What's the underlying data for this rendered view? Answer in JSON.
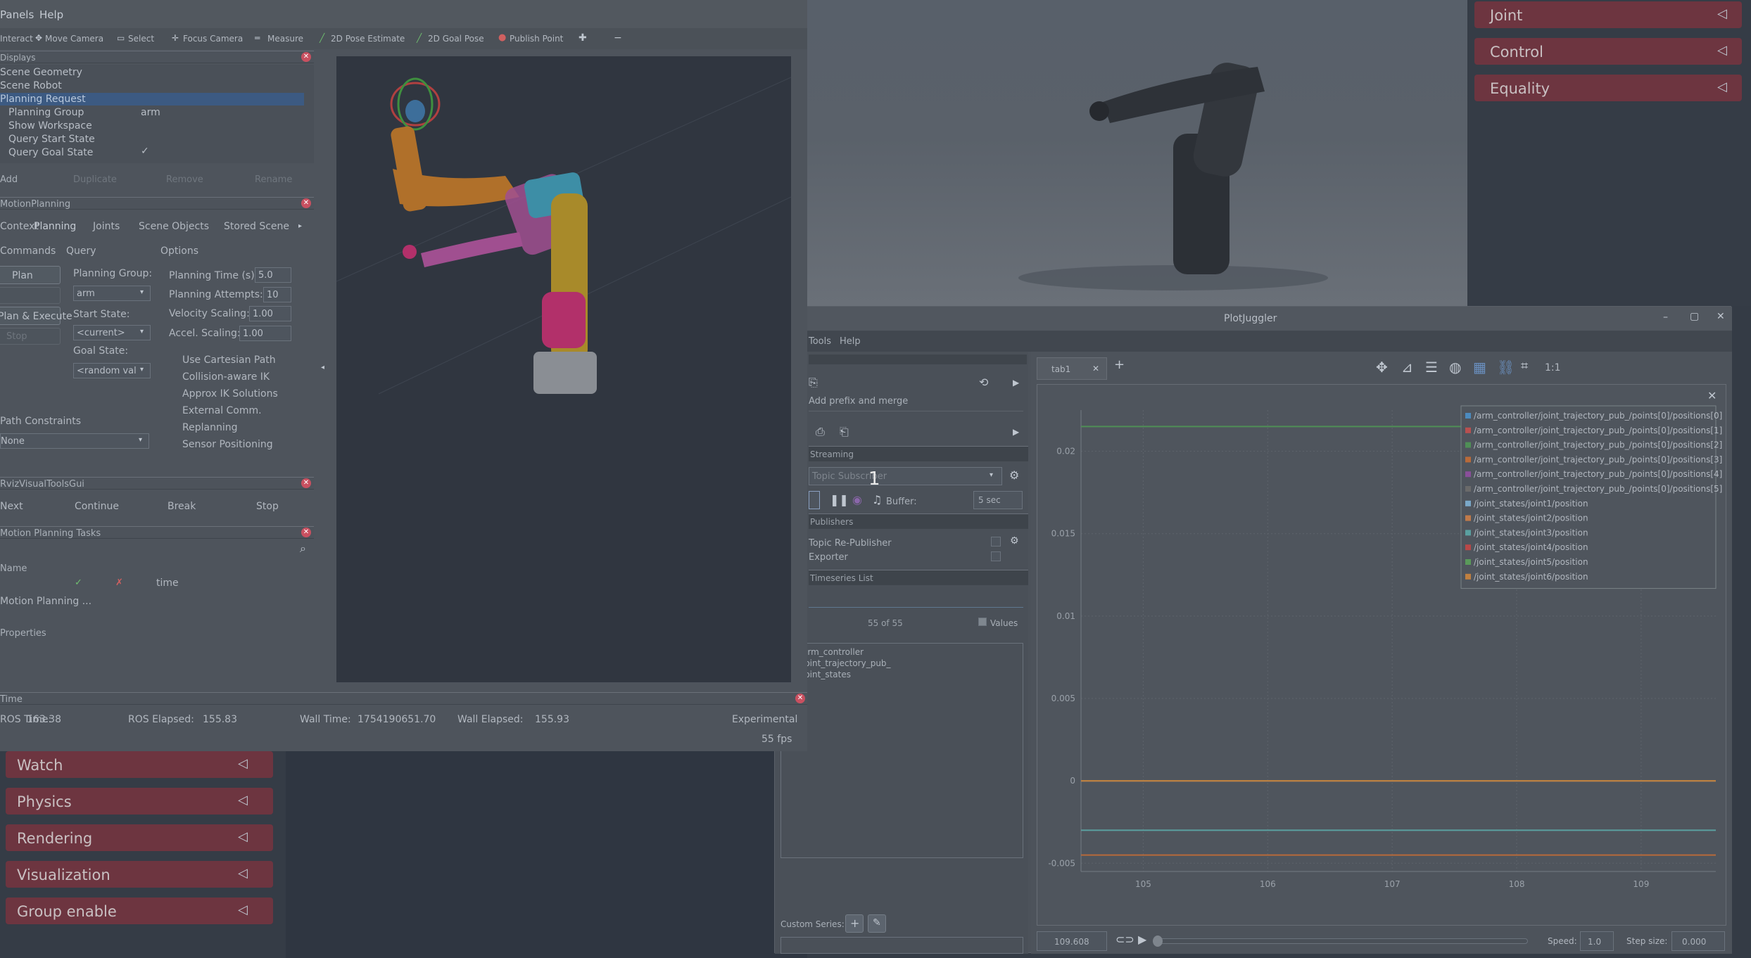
{
  "rviz": {
    "menu": [
      "Panels",
      "Help"
    ],
    "toolbar": [
      "Interact",
      "Move Camera",
      "Select",
      "Focus Camera",
      "Measure",
      "2D Pose Estimate",
      "2D Goal Pose",
      "Publish Point"
    ],
    "displays_title": "Displays",
    "displays_items": [
      {
        "label": "Scene Geometry",
        "value": ""
      },
      {
        "label": "Scene Robot",
        "value": ""
      },
      {
        "label": "Planning Request",
        "value": ""
      },
      {
        "label": "Planning Group",
        "value": "arm"
      },
      {
        "label": "Show Workspace",
        "value": ""
      },
      {
        "label": "Query Start State",
        "value": ""
      },
      {
        "label": "Query Goal State",
        "value": "✓"
      }
    ],
    "displays_buttons": [
      "Add",
      "Duplicate",
      "Remove",
      "Rename"
    ],
    "motion_title": "MotionPlanning",
    "motion_tabs": [
      "Context",
      "Planning",
      "Joints",
      "Scene Objects",
      "Stored Scene"
    ],
    "commands_label": "Commands",
    "query_label": "Query",
    "options_label": "Options",
    "plan_button": "Plan",
    "plan_execute_button": "Plan & Execute",
    "stop_button": "Stop",
    "planning_group_label": "Planning Group:",
    "planning_group_value": "arm",
    "start_state_label": "Start State:",
    "start_state_value": "<current>",
    "goal_state_label": "Goal State:",
    "goal_state_value": "<random val",
    "planning_time_label": "Planning Time (s):",
    "planning_time_value": "5.0",
    "planning_attempts_label": "Planning Attempts:",
    "planning_attempts_value": "10",
    "velocity_label": "Velocity Scaling:",
    "velocity_value": "1.00",
    "accel_label": "Accel. Scaling:",
    "accel_value": "1.00",
    "checks": [
      "Use Cartesian Path",
      "Collision-aware IK",
      "Approx IK Solutions",
      "External Comm.",
      "Replanning",
      "Sensor Positioning"
    ],
    "path_constraints_label": "Path Constraints",
    "path_constraints_value": "None",
    "rvt_title": "RvizVisualToolsGui",
    "rvt_buttons": [
      "Next",
      "Continue",
      "Break",
      "Stop"
    ],
    "mpt_title": "Motion Planning Tasks",
    "mpt_name_col": "Name",
    "mpt_time_col": "time",
    "mpt_row": "Motion Planning ...",
    "mpt_properties": "Properties",
    "time_title": "Time",
    "ros_time_label": "ROS Time:",
    "ros_time_value": "163.38",
    "ros_elapsed_label": "ROS Elapsed:",
    "ros_elapsed_value": "155.83",
    "wall_time_label": "Wall Time:",
    "wall_time_value": "1754190651.70",
    "wall_elapsed_label": "Wall Elapsed:",
    "wall_elapsed_value": "155.93",
    "experimental": "Experimental",
    "fps": "55 fps"
  },
  "mujoco": {
    "right_sections": [
      "Joint",
      "Control",
      "Equality"
    ],
    "left_sections": [
      "Watch",
      "Physics",
      "Rendering",
      "Visualization",
      "Group enable"
    ]
  },
  "plotjuggler": {
    "title": "PlotJuggler",
    "menu": [
      "Tools",
      "Help"
    ],
    "prefix_merge": "Add prefix and merge",
    "streaming_label": "Streaming",
    "topic_placeholder": "Topic Subscriber",
    "buffer_label": "Buffer:",
    "buffer_value": "5 sec",
    "publishers_label": "Publishers",
    "republisher_label": "Topic Re-Publisher",
    "exporter_label": "Exporter",
    "timeseries_label": "Timeseries List",
    "count_label": "55 of 55",
    "values_label": "Values",
    "tree": [
      "arm_controller",
      "joint_trajectory_pub_",
      "joint_states"
    ],
    "custom_series_label": "Custom Series:",
    "tab_label": "tab1",
    "current_time": "109.608",
    "speed_label": "Speed:",
    "speed_value": "1.0",
    "step_label": "Step size:",
    "step_value": "0.000",
    "one_to_one": "1:1",
    "badge": "1"
  },
  "chart_data": {
    "type": "line",
    "x_ticks": [
      "105",
      "106",
      "107",
      "108",
      "109"
    ],
    "y_ticks": [
      "0.02",
      "0.015",
      "0.01",
      "0.005",
      "0",
      "-0.005"
    ],
    "xlim": [
      104.5,
      109.6
    ],
    "ylim": [
      -0.0055,
      0.0225
    ],
    "grid": true,
    "legend_position": "top-right",
    "series": [
      {
        "name": "/arm_controller/joint_trajectory_pub_/points[0]/positions[0]",
        "color": "#4c8bbf",
        "x": [
          104.5,
          109.6
        ],
        "y": [
          0,
          0
        ]
      },
      {
        "name": "/arm_controller/joint_trajectory_pub_/points[0]/positions[1]",
        "color": "#b85050",
        "x": [
          104.5,
          109.6
        ],
        "y": [
          0,
          0
        ]
      },
      {
        "name": "/arm_controller/joint_trajectory_pub_/points[0]/positions[2]",
        "color": "#4f8f56",
        "x": [
          104.5,
          109.6
        ],
        "y": [
          0.0215,
          0.0215
        ]
      },
      {
        "name": "/arm_controller/joint_trajectory_pub_/points[0]/positions[3]",
        "color": "#b86a3a",
        "x": [
          104.5,
          109.6
        ],
        "y": [
          -0.0045,
          -0.0045
        ]
      },
      {
        "name": "/arm_controller/joint_trajectory_pub_/points[0]/positions[4]",
        "color": "#8a4f9a",
        "x": [
          104.5,
          109.6
        ],
        "y": [
          0,
          0
        ]
      },
      {
        "name": "/arm_controller/joint_trajectory_pub_/points[0]/positions[5]",
        "color": "#6a6a6a",
        "x": [
          104.5,
          109.6
        ],
        "y": [
          0,
          0
        ]
      },
      {
        "name": "/joint_states/joint1/position",
        "color": "#7aa8c8",
        "x": [
          104.5,
          109.6
        ],
        "y": [
          0,
          0
        ]
      },
      {
        "name": "/joint_states/joint2/position",
        "color": "#c07a4a",
        "x": [
          104.5,
          109.6
        ],
        "y": [
          0,
          0
        ]
      },
      {
        "name": "/joint_states/joint3/position",
        "color": "#5aa0a0",
        "x": [
          104.5,
          109.6
        ],
        "y": [
          -0.003,
          -0.003
        ]
      },
      {
        "name": "/joint_states/joint4/position",
        "color": "#b84848",
        "x": [
          104.5,
          109.6
        ],
        "y": [
          0,
          0
        ]
      },
      {
        "name": "/joint_states/joint5/position",
        "color": "#5a9a5a",
        "x": [
          104.5,
          109.6
        ],
        "y": [
          0,
          0
        ]
      },
      {
        "name": "/joint_states/joint6/position",
        "color": "#c08040",
        "x": [
          104.5,
          109.6
        ],
        "y": [
          0,
          0
        ]
      }
    ]
  }
}
